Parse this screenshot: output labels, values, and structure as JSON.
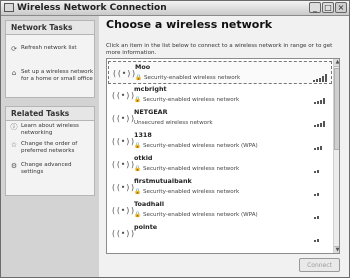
{
  "window": {
    "title": "Wireless Network Connection"
  },
  "sidebar": {
    "network_tasks": {
      "heading": "Network Tasks",
      "items": [
        {
          "label": "Refresh network list",
          "icon": "refresh-icon"
        },
        {
          "label": "Set up a wireless network for a home or small office",
          "icon": "setup-network-icon"
        }
      ]
    },
    "related_tasks": {
      "heading": "Related Tasks",
      "items": [
        {
          "label": "Learn about wireless networking",
          "icon": "info-icon"
        },
        {
          "label": "Change the order of preferred networks",
          "icon": "star-icon"
        },
        {
          "label": "Change advanced settings",
          "icon": "settings-icon"
        }
      ]
    }
  },
  "main": {
    "title": "Choose a wireless network",
    "instructions": "Click an item in the list below to connect to a wireless network in range or to get more information.",
    "networks": [
      {
        "ssid": "Moo",
        "security": "Security-enabled wireless network",
        "signal_bars": 5
      },
      {
        "ssid": "mcbright",
        "security": "Security-enabled wireless network",
        "signal_bars": 4
      },
      {
        "ssid": "NETGEAR",
        "security": "Unsecured wireless network",
        "signal_bars": 4
      },
      {
        "ssid": "1318",
        "security": "Security-enabled wireless network (WPA)",
        "signal_bars": 3
      },
      {
        "ssid": "otkid",
        "security": "Security-enabled wireless network",
        "signal_bars": 2
      },
      {
        "ssid": "firstmutualbank",
        "security": "Security-enabled wireless network",
        "signal_bars": 2
      },
      {
        "ssid": "Toadhall",
        "security": "Security-enabled wireless network (WPA)",
        "signal_bars": 2
      },
      {
        "ssid": "pointe",
        "security": "",
        "signal_bars": 2
      }
    ],
    "connect_label": "Connect"
  }
}
